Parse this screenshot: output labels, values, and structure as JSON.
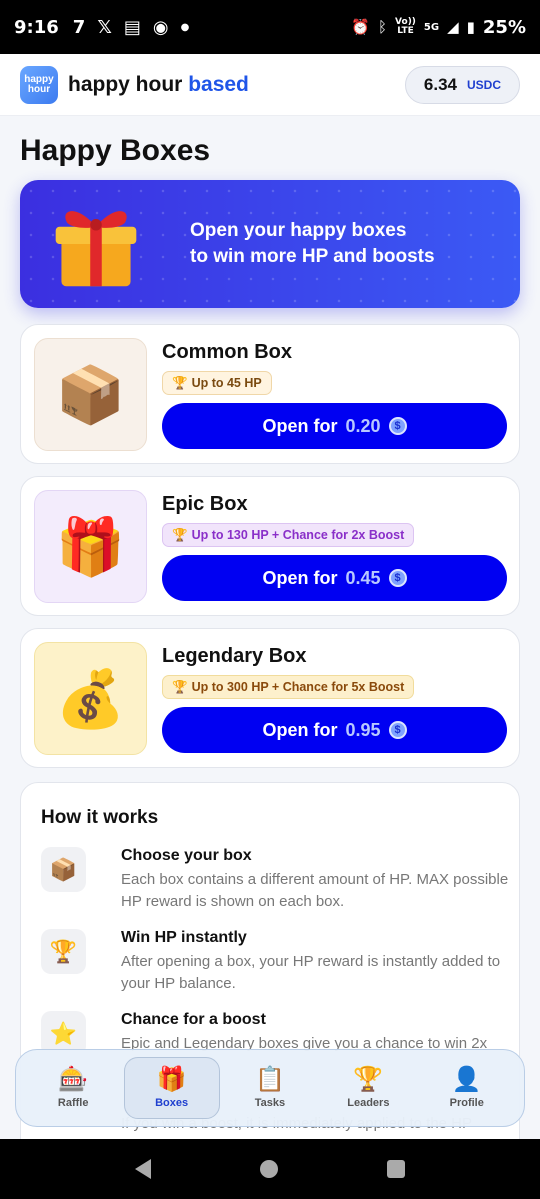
{
  "status_bar": {
    "time": "9:16",
    "left_icons": [
      "seven-app-icon",
      "x-icon",
      "news-icon",
      "whatsapp-icon",
      "dot-icon"
    ],
    "volte_top": "Vo))",
    "volte_bottom": "LTE",
    "network": "5G",
    "battery": "25%"
  },
  "header": {
    "logo_line1": "happy",
    "logo_line2": "hour",
    "brand_main": "happy hour",
    "brand_accent": "based",
    "balance_amount": "6.34",
    "balance_currency": "USDC"
  },
  "page_title": "Happy Boxes",
  "hero": {
    "line1": "Open your happy boxes",
    "line2": "to win more HP and boosts"
  },
  "boxes": [
    {
      "name": "Common Box",
      "badge": "Up to 45 HP",
      "button_label": "Open for",
      "price": "0.20",
      "icon": "package-icon",
      "thumb_bg": "#f8f1ea",
      "thumb_border": "#ecdfd1",
      "badge_bg": "#fff4e0",
      "badge_border": "#f0d7a8",
      "badge_color": "#7a4a10"
    },
    {
      "name": "Epic Box",
      "badge": "Up to 130 HP + Chance for 2x Boost",
      "button_label": "Open for",
      "price": "0.45",
      "icon": "gift-icon",
      "thumb_bg": "#f3ecfc",
      "thumb_border": "#e3d6f5",
      "badge_bg": "#f1e4fb",
      "badge_border": "#dcc4f2",
      "badge_color": "#8a2fc9"
    },
    {
      "name": "Legendary Box",
      "badge": "Up to 300 HP + Chance for 5x Boost",
      "button_label": "Open for",
      "price": "0.95",
      "icon": "money-bag-icon",
      "thumb_bg": "#fdf2c9",
      "thumb_border": "#f3e3a4",
      "badge_bg": "#fdf0cc",
      "badge_border": "#f1dc9c",
      "badge_color": "#8a4a0c"
    }
  ],
  "how_it_works": {
    "title": "How it works",
    "steps": [
      {
        "title": "Choose your box",
        "desc": "Each box contains a different amount of HP. MAX possible HP reward is shown on each box.",
        "icon": "package-icon"
      },
      {
        "title": "Win HP instantly",
        "desc": "After opening a box, your HP reward is instantly added to your HP balance.",
        "icon": "trophy-icon"
      },
      {
        "title": "Chance for a boost",
        "desc": "Epic and Legendary boxes give you a chance to win 2x",
        "icon": "star-icon"
      }
    ],
    "cut_off_text": "If you win a boost, it is immediately applied to the HP"
  },
  "bottom_nav": [
    {
      "label": "Raffle",
      "icon": "slot-machine-icon",
      "glyph": "🎰",
      "active": false
    },
    {
      "label": "Boxes",
      "icon": "gift-icon",
      "glyph": "🎁",
      "active": true
    },
    {
      "label": "Tasks",
      "icon": "clipboard-icon",
      "glyph": "📋",
      "active": false
    },
    {
      "label": "Leaders",
      "icon": "trophy-icon",
      "glyph": "🏆",
      "active": false
    },
    {
      "label": "Profile",
      "icon": "profile-icon",
      "glyph": "👤",
      "active": false
    }
  ]
}
